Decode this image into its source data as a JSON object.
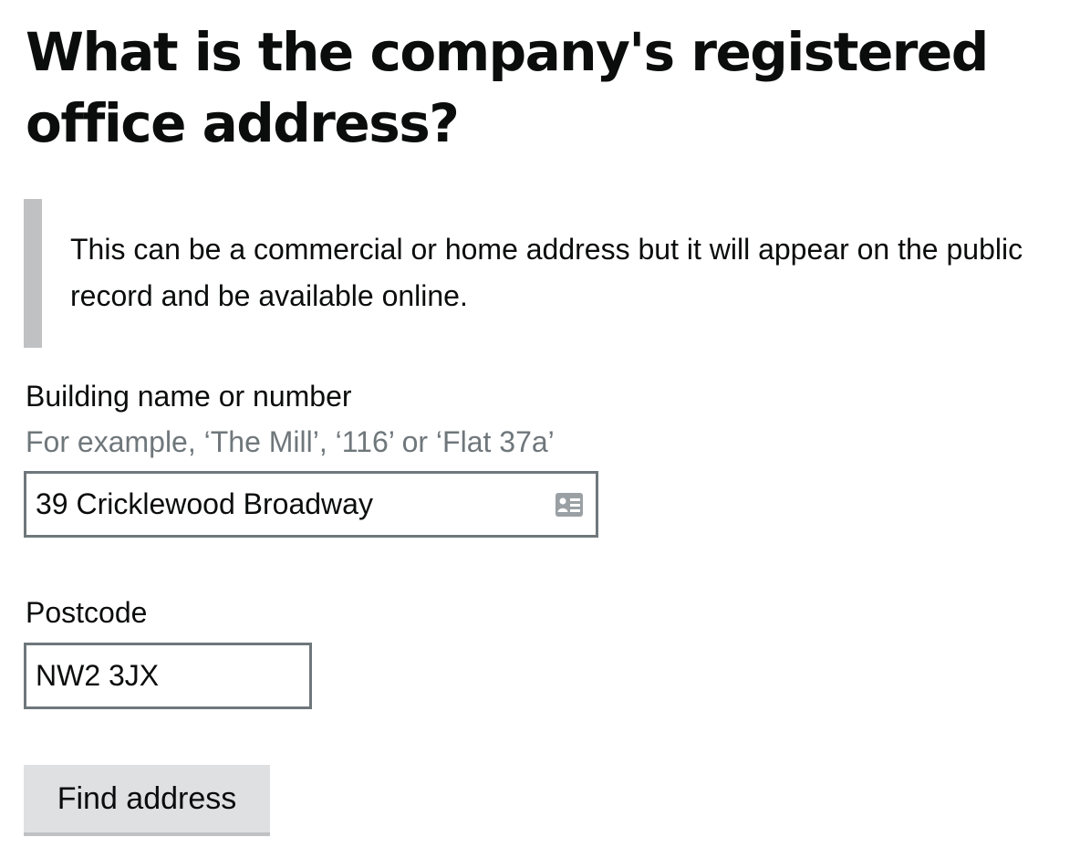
{
  "page": {
    "heading": "What is the company's registered office address?",
    "inset_text": "This can be a commercial or home address but it will appear on the public record and be available online."
  },
  "building": {
    "label": "Building name or number",
    "hint": "For example, ‘The Mill’, ‘116’ or ‘Flat 37a’",
    "value": "39 Cricklewood Broadway",
    "icon": "contact-card-icon"
  },
  "postcode": {
    "label": "Postcode",
    "value": "NW2 3JX"
  },
  "actions": {
    "find_address_label": "Find address"
  },
  "colors": {
    "text": "#0b0c0c",
    "hint": "#6f777b",
    "inset_border": "#bfc1c3",
    "input_border": "#6f777b",
    "button_bg": "#dee0e2"
  }
}
